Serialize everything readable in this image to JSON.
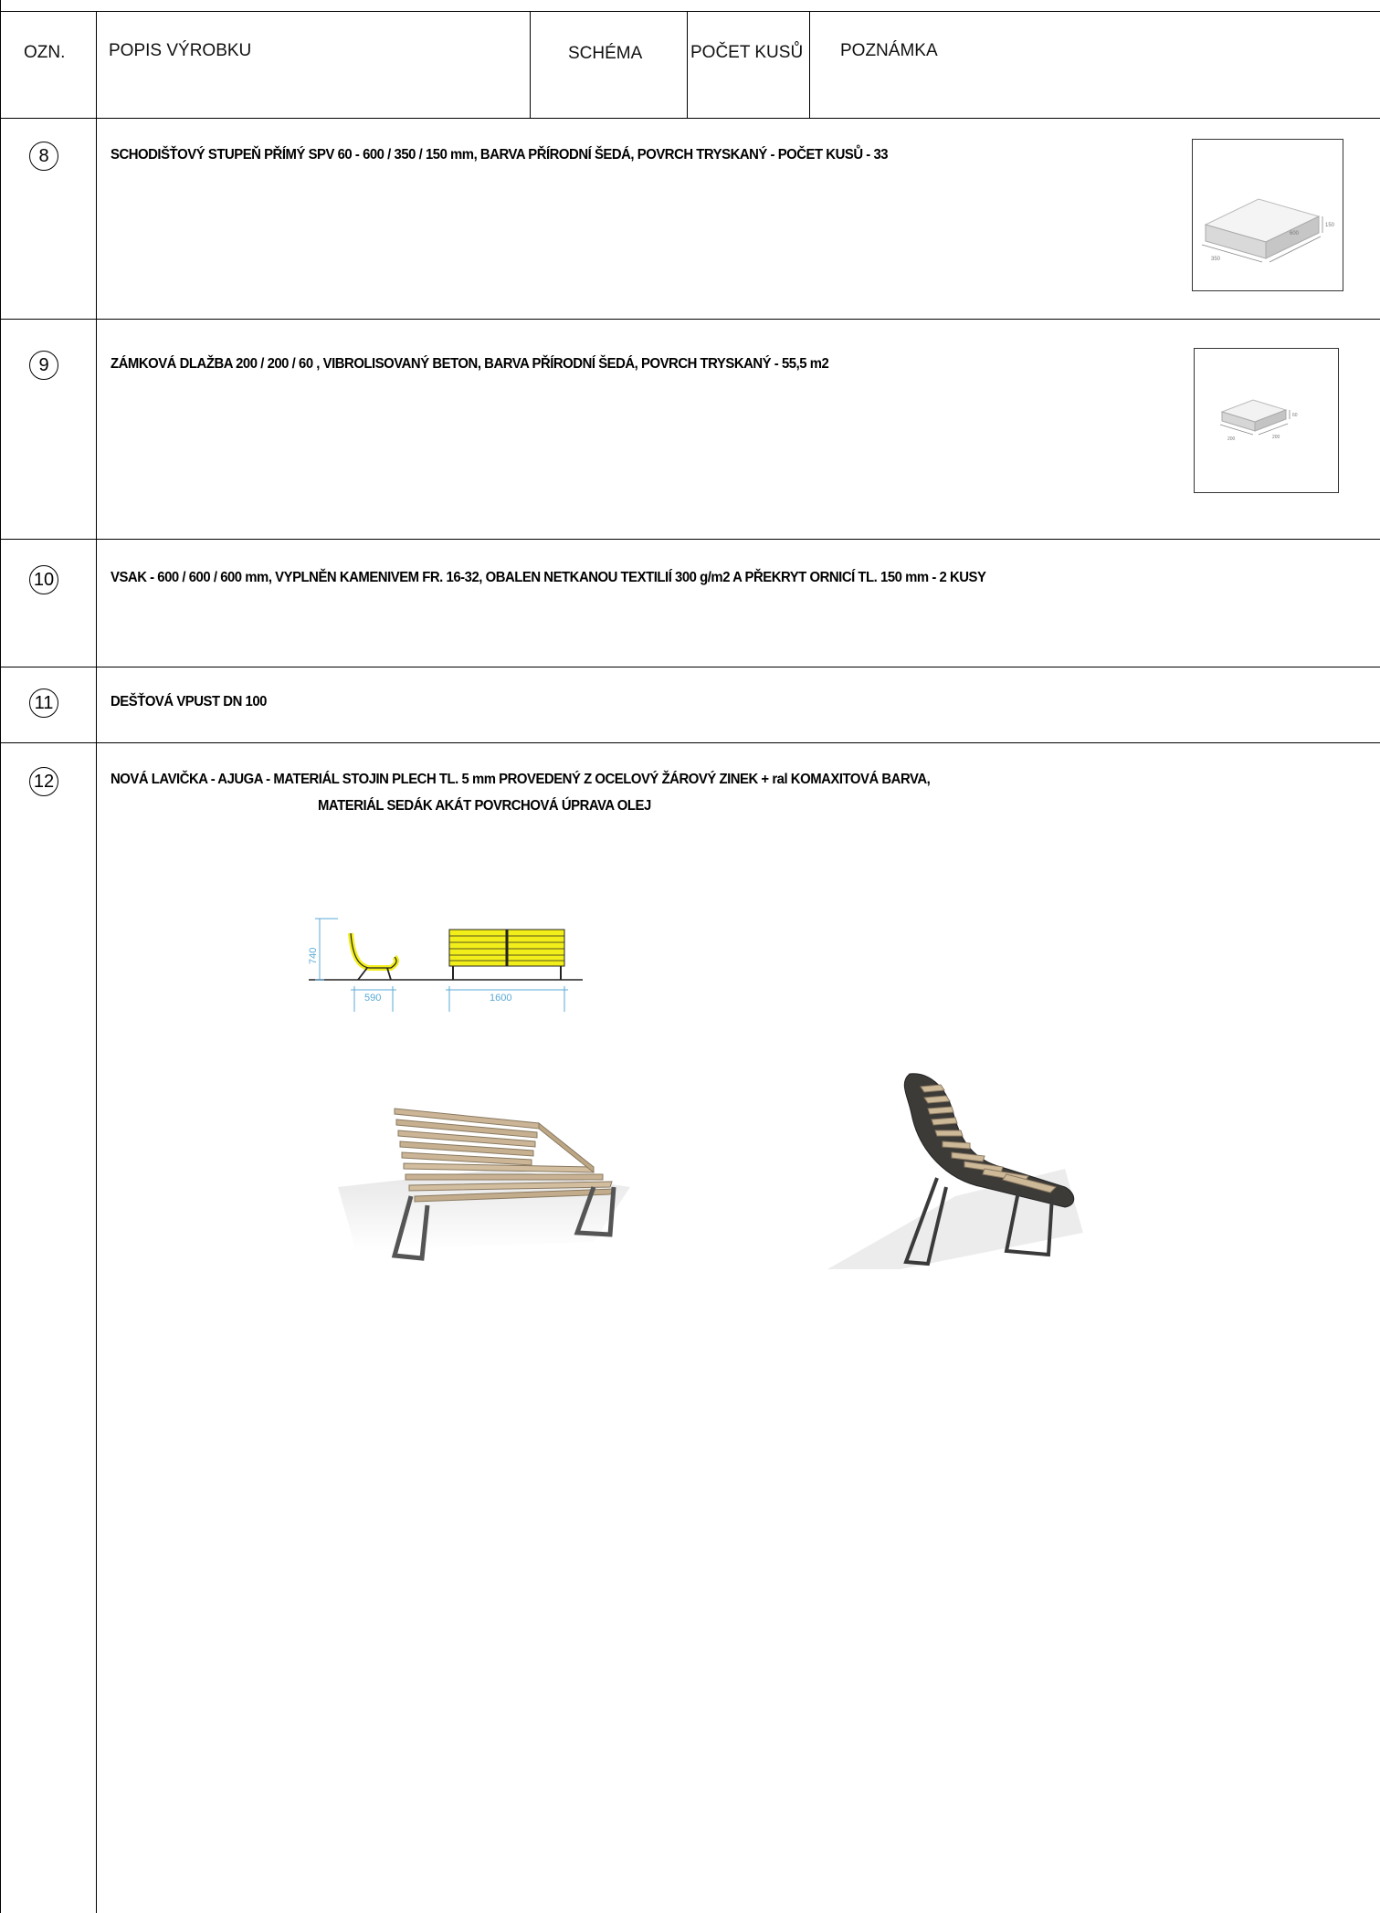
{
  "header": {
    "col_ozn": "OZN.",
    "col_popis": "POPIS VÝROBKU",
    "col_schema": "SCHÉMA",
    "col_pocet": "POČET KUSŮ",
    "col_poznamka": "POZNÁMKA"
  },
  "rows": [
    {
      "number": "8",
      "description": "SCHODIŠŤOVÝ STUPEŇ PŘÍMÝ SPV 60 - 600 / 350 / 150 mm, BARVA PŘÍRODNÍ ŠEDÁ, POVRCH TRYSKANÝ - POČET KUSŮ - 33",
      "thumb_labels": [
        "350",
        "600",
        "150"
      ]
    },
    {
      "number": "9",
      "description": "ZÁMKOVÁ DLAŽBA 200 / 200 / 60 , VIBROLISOVANÝ BETON, BARVA PŘÍRODNÍ ŠEDÁ, POVRCH TRYSKANÝ - 55,5 m2",
      "thumb_labels": [
        "200",
        "200",
        "60"
      ]
    },
    {
      "number": "10",
      "description": "VSAK - 600 / 600 / 600 mm, VYPLNĚN KAMENIVEM FR. 16-32, OBALEN NETKANOU TEXTILIÍ 300 g/m2 A PŘEKRYT ORNICÍ TL. 150 mm   - 2 KUSY"
    },
    {
      "number": "11",
      "description": "DEŠŤOVÁ VPUST DN 100"
    },
    {
      "number": "12",
      "description": "NOVÁ LAVIČKA - AJUGA - MATERIÁL STOJIN PLECH TL. 5 mm PROVEDENÝ Z OCELOVÝ ŽÁROVÝ ZINEK + ral KOMAXITOVÁ BARVA,",
      "description_line2": "MATERIÁL SEDÁK AKÁT POVRCHOVÁ ÚPRAVA OLEJ"
    }
  ],
  "bench_drawing": {
    "height_label": "740",
    "depth_label": "590",
    "length_label": "1600",
    "highlight_color": "#f2ee1a",
    "dimension_color": "#5aa9d6"
  }
}
